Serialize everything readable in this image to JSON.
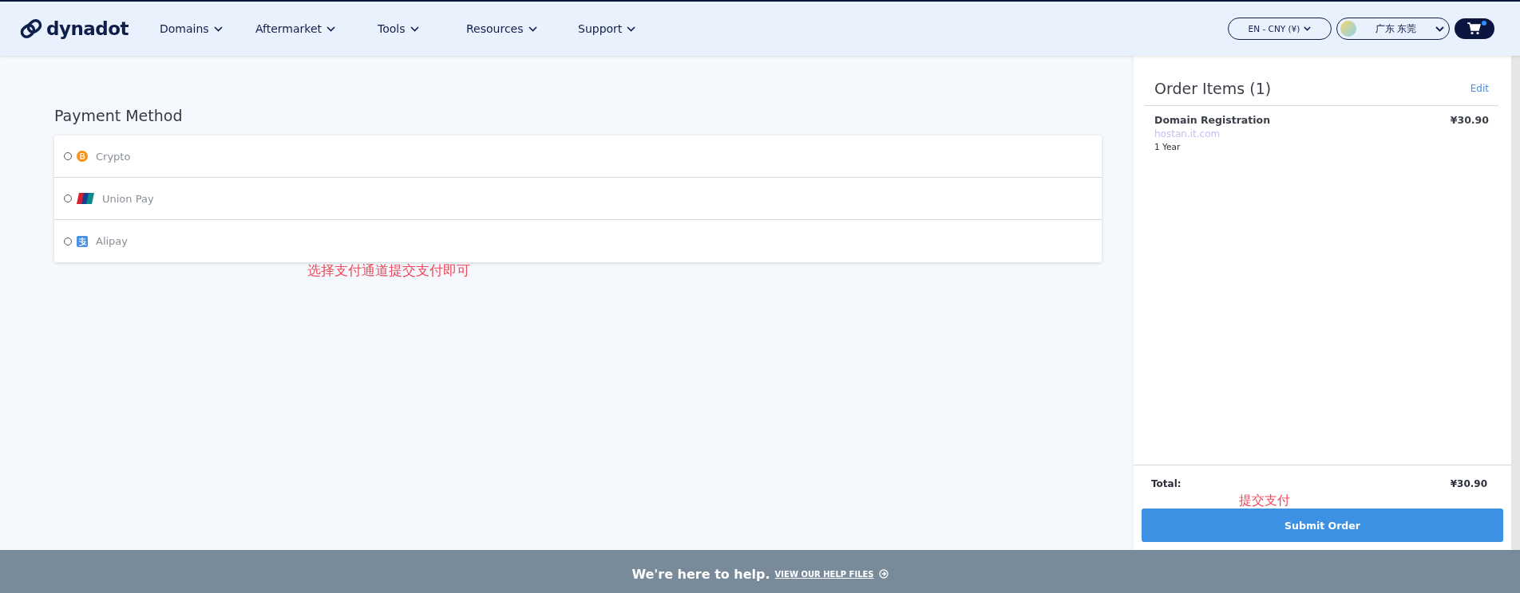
{
  "header": {
    "logo": "dynadot",
    "nav": [
      {
        "label": "Domains"
      },
      {
        "label": "Aftermarket"
      },
      {
        "label": "Tools"
      },
      {
        "label": "Resources"
      },
      {
        "label": "Support"
      }
    ],
    "currency": "EN - CNY (¥)",
    "location": "广东 东莞",
    "cart_has_items": true
  },
  "payment": {
    "title": "Payment Method",
    "methods": [
      {
        "kind": "crypto",
        "label": "Crypto",
        "selected": false
      },
      {
        "kind": "unionpay",
        "label": "Union Pay",
        "selected": false
      },
      {
        "kind": "alipay",
        "label": "Alipay",
        "selected": false
      }
    ]
  },
  "annotations": [
    {
      "kind": "note",
      "text": "选择支付通道提交支付即可"
    },
    {
      "kind": "submit",
      "text": "提交支付"
    }
  ],
  "order": {
    "title": "Order Items (1)",
    "edit": "Edit",
    "items": [
      {
        "name": "Domain Registration",
        "price": "¥30.90",
        "domain": "hostan.it.com",
        "term": "1 Year"
      }
    ],
    "total_label": "Total:",
    "total": "¥30.90",
    "submit": "Submit Order"
  },
  "footer": {
    "text": "We're here to help.",
    "link": "VIEW OUR HELP FILES"
  }
}
